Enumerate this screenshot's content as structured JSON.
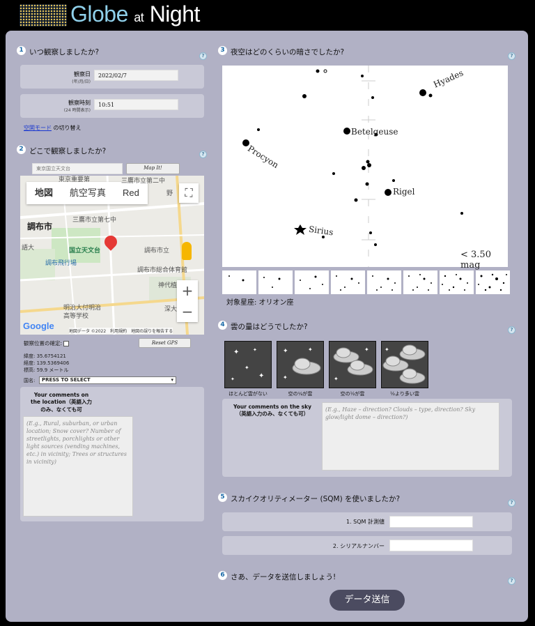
{
  "header": {
    "logo_globe": "Globe",
    "logo_at": "at",
    "logo_night": "Night"
  },
  "step1": {
    "num": "1",
    "title": "いつ観察しましたか?",
    "date_label": "観察日",
    "date_sub": "(年/月/日)",
    "date_value": "2022/02/7",
    "time_label": "観察時刻",
    "time_sub": "(24 時間表示)",
    "time_value": "10:51",
    "link_text": "空閑モード",
    "link_suffix": "の切り替え"
  },
  "step2": {
    "num": "2",
    "title": "どこで観察しましたか?",
    "search_placeholder": "東京国立天文台",
    "mapit": "Map It!",
    "map": {
      "tab_map": "地図",
      "tab_aerial": "航空写真",
      "tab_red": "Red",
      "labels": [
        "調布市",
        "三鷹市立第七中",
        "国立天文台",
        "調布市立",
        "調布飛行場",
        "調布市総合体育館",
        "神代植物",
        "明治大付明治",
        "高等学校",
        "深大",
        "語大",
        "東京重要第",
        "三鷹市立第二中",
        "野"
      ],
      "google": "Google",
      "footer": "地図データ ©2022　利用規約　地図の誤りを報告する"
    },
    "confirm_label": "観察位置の確定:",
    "reset_gps": "Reset GPS",
    "lat": "緯度: 35.6754121",
    "lon": "経度: 139.5369406",
    "alt": "標高: 59.9 メートル",
    "country_label": "国名:",
    "country_value": "PRESS TO SELECT",
    "comments_label": "Your comments on the location（英語入力のみ、なくても可",
    "comments_placeholder": "(E.g., Rural, suburban, or urban location; Snow cover? Number of streetlights, porchlights or other light sources (vending machines, etc.) in vicinity; Trees or structures in vicinity)"
  },
  "step3": {
    "num": "3",
    "title": "夜空はどのくらいの暗さでしたか?",
    "stars": [
      "Hyades",
      "Betelgeuse",
      "Procyon",
      "Rigel",
      "Sirius"
    ],
    "mag": "< 3.50 mag",
    "constellation": "対象星座: オリオン座"
  },
  "step4": {
    "num": "4",
    "title": "雲の量はどうでしたか?",
    "options": [
      "ほとんど雲がない",
      "空の¼が雲",
      "空の½が雲",
      "½より多い雲"
    ],
    "comments_label": "Your comments on the sky（英語入力のみ、なくても可）",
    "comments_placeholder": "(E.g., Haze – direction? Clouds – type, direction? Sky glow/light dome – direction?)"
  },
  "step5": {
    "num": "5",
    "title": "スカイクオリティメーター (SQM) を使いましたか?",
    "sqm_label": "1. SQM 計測値",
    "serial_label": "2. シリアルナンバー"
  },
  "step6": {
    "num": "6",
    "title": "さあ、データを送信しましょう!",
    "submit": "データ送信"
  },
  "help": "?"
}
